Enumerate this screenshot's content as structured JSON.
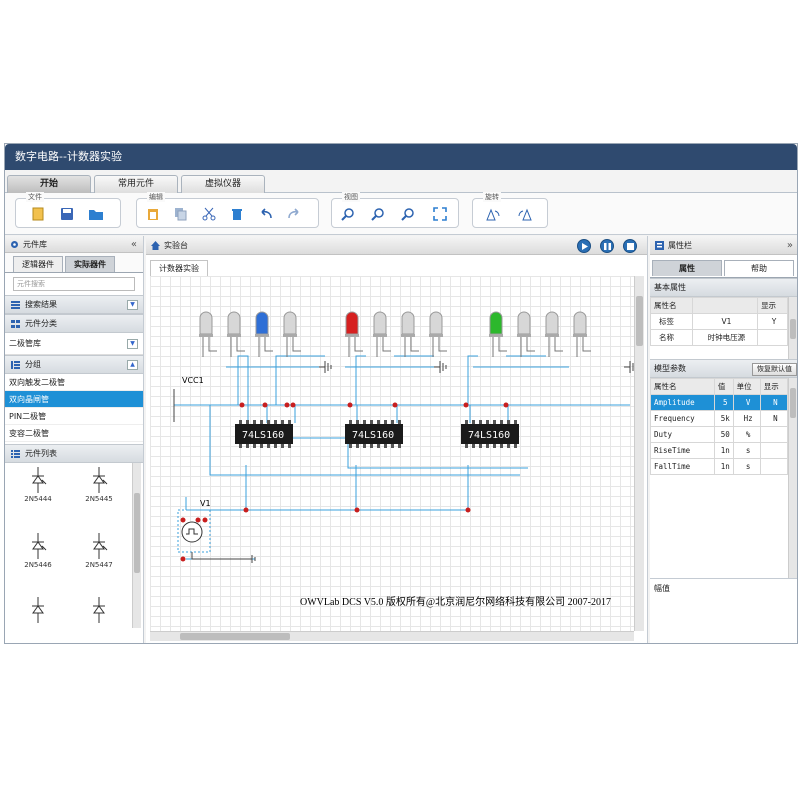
{
  "app": {
    "title": "数字电路--计数器实验"
  },
  "main_tabs": [
    "开始",
    "常用元件",
    "虚拟仪器"
  ],
  "ribbon": {
    "groups": [
      {
        "label": "文件",
        "buttons": [
          "new-file",
          "save",
          "open"
        ]
      },
      {
        "label": "编辑",
        "buttons": [
          "paste",
          "copy",
          "cut",
          "delete",
          "undo",
          "redo"
        ]
      },
      {
        "label": "视图",
        "buttons": [
          "zoom-in",
          "zoom-out",
          "zoom-fit",
          "fullscreen"
        ]
      },
      {
        "label": "旋转",
        "buttons": [
          "rotate-left",
          "rotate-right"
        ]
      }
    ]
  },
  "left_panel": {
    "title": "元件库",
    "tabs": [
      "逻辑器件",
      "实际器件"
    ],
    "active_tab": "实际器件",
    "search_placeholder": "元件搜索",
    "sections": {
      "search_results": "搜索结果",
      "category": "元件分类",
      "group": "分组",
      "list": "元件列表"
    },
    "category_selected": "二极管库",
    "groups": [
      "双向触发二极管",
      "双向晶闸管",
      "PIN二极管",
      "变容二极管"
    ],
    "selected_group": "双向晶闸管",
    "components": [
      "2N5444",
      "2N5445",
      "2N5446",
      "2N5447",
      "",
      ""
    ]
  },
  "center": {
    "title": "实验台",
    "tab": "计数器实验",
    "chips": [
      "74LS160",
      "74LS160",
      "74LS160"
    ],
    "labels": {
      "vcc": "VCC1",
      "source": "V1"
    },
    "copyright": "OWVLab DCS   V5.0 版权所有@北京润尼尔网络科技有限公司  2007-2017",
    "leds": [
      "#d7d7d7",
      "#d7d7d7",
      "#2f6fd6",
      "#d7d7d7",
      "#d62020",
      "#d7d7d7",
      "#d7d7d7",
      "#d7d7d7",
      "#2cb82c",
      "#d7d7d7",
      "#d7d7d7",
      "#d7d7d7"
    ]
  },
  "right_panel": {
    "title": "属性栏",
    "tabs": [
      "属性",
      "帮助"
    ],
    "active_tab": "属性",
    "basic": {
      "header": "基本属性",
      "cols": [
        "属性名",
        "",
        "显示"
      ],
      "rows": [
        [
          "标签",
          "V1",
          "Y"
        ],
        [
          "名称",
          "时钟电压源",
          ""
        ]
      ]
    },
    "model": {
      "header": "模型参数",
      "restore_button": "恢复默认值",
      "cols": [
        "属性名",
        "值",
        "单位",
        "显示"
      ],
      "rows": [
        [
          "Amplitude",
          "5",
          "V",
          "N"
        ],
        [
          "Frequency",
          "5k",
          "Hz",
          "N"
        ],
        [
          "Duty",
          "50",
          "%",
          ""
        ],
        [
          "RiseTime",
          "1n",
          "s",
          ""
        ],
        [
          "FallTime",
          "1n",
          "s",
          ""
        ]
      ],
      "selected_row": 0
    },
    "description": "幅值"
  }
}
